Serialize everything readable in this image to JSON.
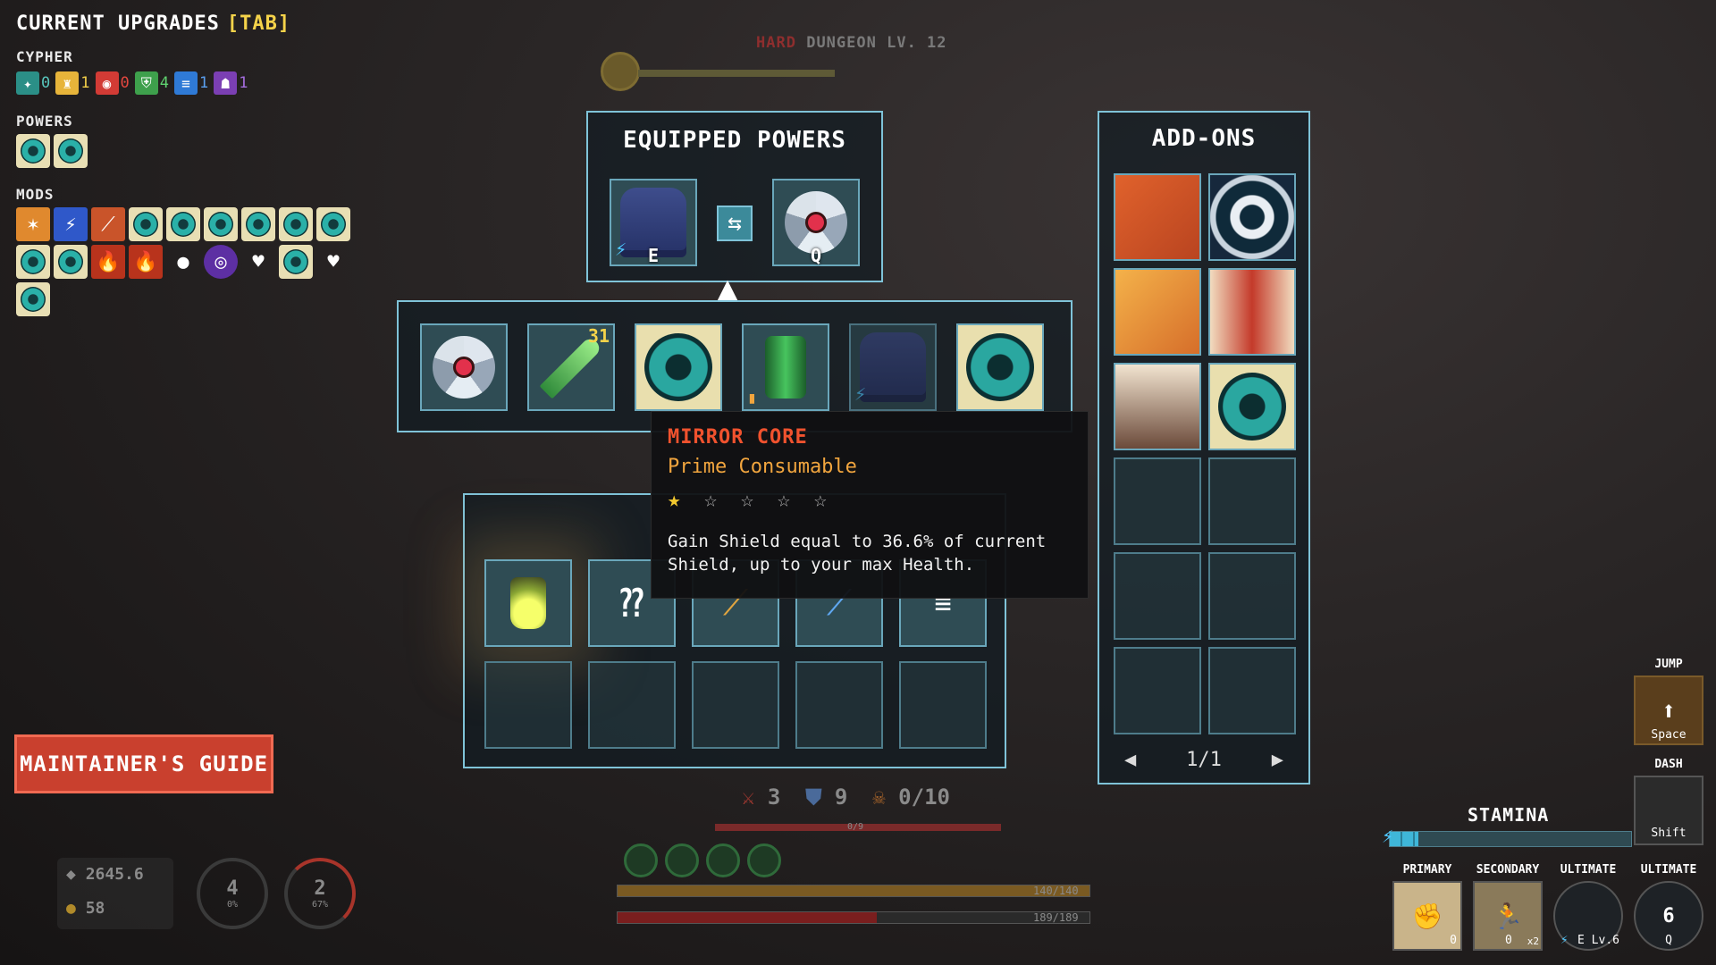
{
  "upgrades": {
    "title": "CURRENT UPGRADES",
    "tab_hint": "[TAB]",
    "cypher_label": "CYPHER",
    "cypher": [
      {
        "icon": "cypher-teal-icon",
        "count": "0",
        "color": "#2b8f87"
      },
      {
        "icon": "cypher-yellow-icon",
        "count": "1",
        "color": "#e7b43a"
      },
      {
        "icon": "cypher-red-icon",
        "count": "0",
        "color": "#d23b35"
      },
      {
        "icon": "cypher-green-icon",
        "count": "4",
        "color": "#3ea04c"
      },
      {
        "icon": "cypher-blue-icon",
        "count": "1",
        "color": "#2f7ad6"
      },
      {
        "icon": "cypher-purple-icon",
        "count": "1",
        "color": "#7b3fb3"
      }
    ],
    "powers_label": "POWERS",
    "mods_label": "MODS"
  },
  "dungeon": {
    "difficulty": "HARD",
    "name": "DUNGEON",
    "level": "LV. 12"
  },
  "equipped": {
    "title": "EQUIPPED POWERS",
    "slot_e_key": "E",
    "slot_q_key": "Q",
    "swap_icon": "⇆",
    "up_arrow": "▲"
  },
  "inventory": {
    "feather_count": "31"
  },
  "tooltip": {
    "name": "MIRROR CORE",
    "type": "Prime Consumable",
    "stars_filled": 1,
    "stars_total": 5,
    "star_on": "★",
    "star_off": "☆ ☆ ☆ ☆",
    "description": "Gain Shield equal to 36.6% of current Shield, up to your max Health."
  },
  "addons": {
    "title": "ADD-ONS",
    "page": "1/1",
    "prev": "◀",
    "next": "▶"
  },
  "guide": {
    "label": "MAINTAINER'S GUIDE"
  },
  "hud": {
    "attack": "3",
    "shield": "9",
    "kills": "0/10",
    "hp_small": "0/9",
    "energy_text": "140/140",
    "health_text": "189/189",
    "score": "2645.6",
    "coins": "58",
    "cd1_value": "4",
    "cd1_pct": "0%",
    "cd2_value": "2",
    "cd2_pct": "67%",
    "energy_fraction": 1.0,
    "health_fraction": 0.55,
    "stamina_label": "STAMINA",
    "stamina_fraction": 0.12,
    "jump_label": "JUMP",
    "jump_key": "Space",
    "dash_label": "DASH",
    "dash_key": "Shift",
    "primary_label": "PRIMARY",
    "secondary_label": "SECONDARY",
    "ultimate1_label": "ULTIMATE",
    "ultimate2_label": "ULTIMATE",
    "ult_level": "E Lv.6",
    "ult2_value": "6",
    "ult2_key": "Q",
    "primary_key": "0",
    "secondary_key": "0",
    "secondary_badge": "x2"
  }
}
